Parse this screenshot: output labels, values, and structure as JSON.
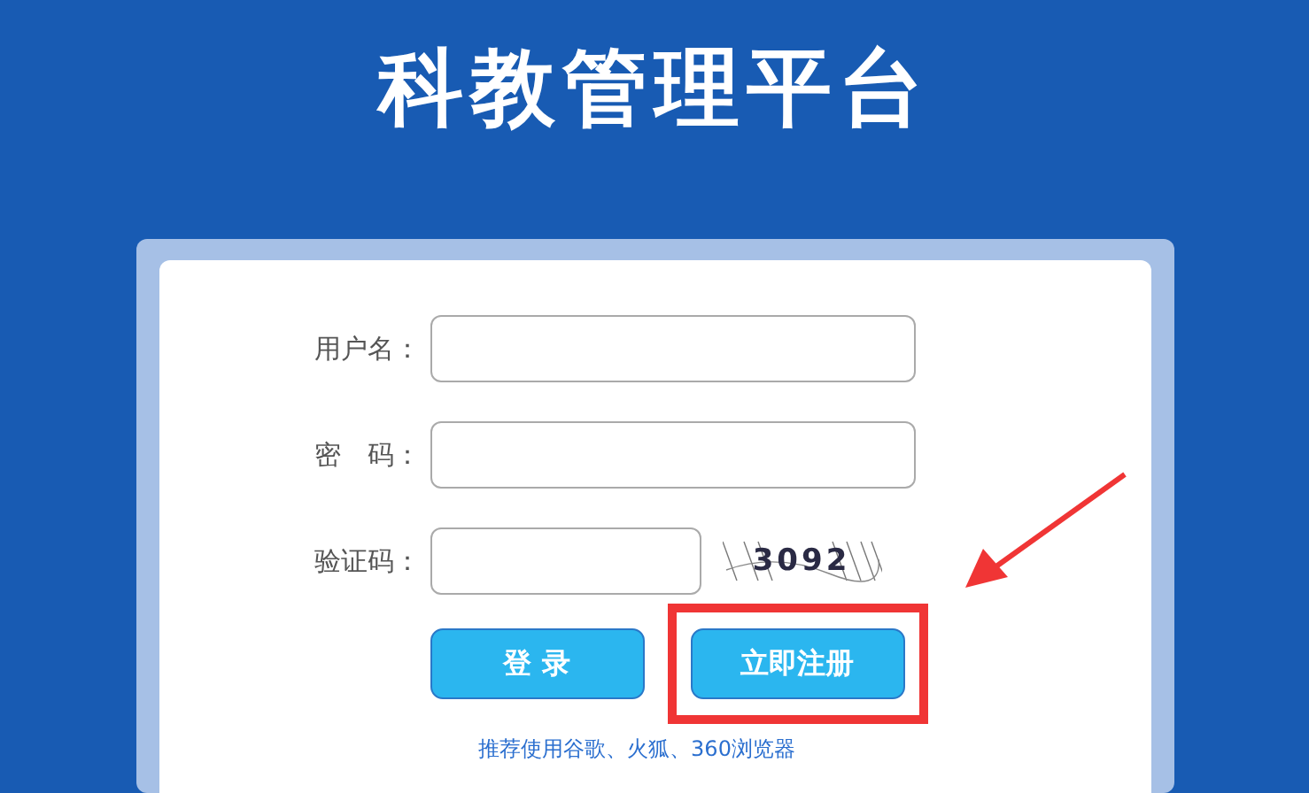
{
  "title": "科教管理平台",
  "fields": [
    {
      "label": "用户名：",
      "kind": "text"
    },
    {
      "label": "密　码：",
      "kind": "password"
    },
    {
      "label": "验证码：",
      "kind": "captcha",
      "captcha": "3092"
    }
  ],
  "buttons": [
    {
      "label": "登 录",
      "highlighted": false
    },
    {
      "label": "立即注册",
      "highlighted": true
    }
  ],
  "footer": "推荐使用谷歌、火狐、360浏览器"
}
